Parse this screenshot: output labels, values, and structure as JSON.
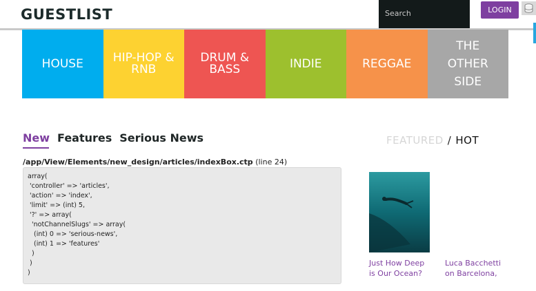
{
  "header": {
    "logo": "GUESTLIST",
    "search_placeholder": "Search",
    "login_label": "LOGIN"
  },
  "genres": [
    "HOUSE",
    "HIP-HOP &\nRNB",
    "DRUM &\nBASS",
    "INDIE",
    "REGGAE",
    "THE\nOTHER\nSIDE"
  ],
  "tabs": [
    "New",
    "Features",
    "Serious News"
  ],
  "featured_label": "FEATURED",
  "slash": "/",
  "hot_label": "HOT",
  "debug": {
    "path": "/app/View/Elements/new_design/articles/indexBox.ctp",
    "line": "(line 24)",
    "code": "array(\n 'controller' => 'articles',\n 'action' => 'index',\n 'limit' => (int) 5,\n '?' => array(\n  'notChannelSlugs' => array(\n   (int) 0 => 'serious-news',\n   (int) 1 => 'features'\n  )\n )\n)"
  },
  "articles": [
    {
      "title": "Just How Deep is Our Ocean?"
    },
    {
      "title": "Luca Bacchetti on Barcelona,"
    }
  ],
  "colors": {
    "accent": "#7e3fa0",
    "house": "#00adee",
    "hiphop": "#fdd231",
    "dnb": "#ee5552",
    "indie": "#9dc02e",
    "reggae": "#f6924a",
    "other": "#a7a7a7"
  }
}
